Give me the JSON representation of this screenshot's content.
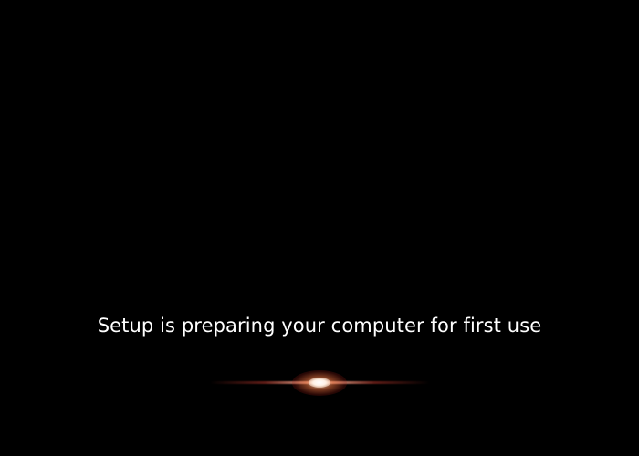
{
  "setup": {
    "status_message": "Setup is preparing your computer for first use"
  },
  "colors": {
    "background": "#000000",
    "text": "#ffffff",
    "glow_core": "#ffffff",
    "glow_accent": "#e06a3c"
  },
  "icons": {
    "progress_glow": "light-streak-icon"
  }
}
